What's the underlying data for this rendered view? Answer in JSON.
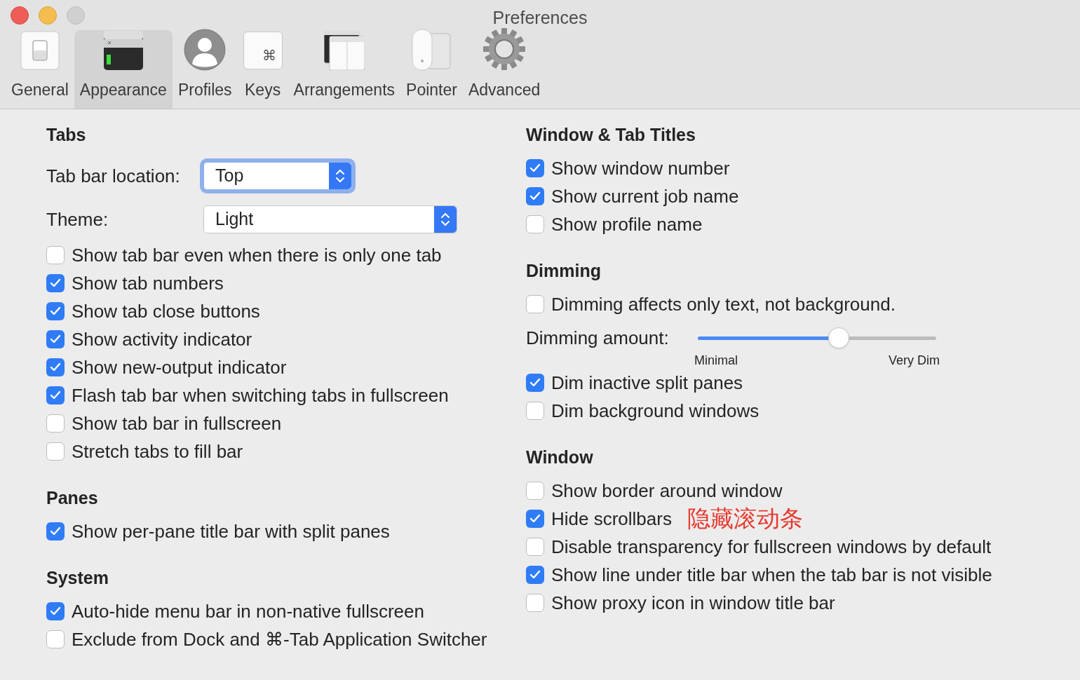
{
  "window": {
    "title": "Preferences"
  },
  "toolbar": [
    {
      "label": "General",
      "selected": false
    },
    {
      "label": "Appearance",
      "selected": true
    },
    {
      "label": "Profiles",
      "selected": false
    },
    {
      "label": "Keys",
      "glyph": "⌘",
      "selected": false
    },
    {
      "label": "Arrangements",
      "selected": false
    },
    {
      "label": "Pointer",
      "selected": false
    },
    {
      "label": "Advanced",
      "selected": false
    }
  ],
  "left_sections": [
    {
      "title": "Tabs",
      "items": [
        {
          "kind": "popup",
          "label": "Tab bar location:",
          "value": "Top",
          "focused": true
        },
        {
          "kind": "popup",
          "label": "Theme:",
          "value": "Light",
          "focused": false
        },
        {
          "kind": "checkbox",
          "label": "Show tab bar even when there is only one tab",
          "checked": false
        },
        {
          "kind": "checkbox",
          "label": "Show tab numbers",
          "checked": true
        },
        {
          "kind": "checkbox",
          "label": "Show tab close buttons",
          "checked": true
        },
        {
          "kind": "checkbox",
          "label": "Show activity indicator",
          "checked": true
        },
        {
          "kind": "checkbox",
          "label": "Show new-output indicator",
          "checked": true
        },
        {
          "kind": "checkbox",
          "label": "Flash tab bar when switching tabs in fullscreen",
          "checked": true
        },
        {
          "kind": "checkbox",
          "label": "Show tab bar in fullscreen",
          "checked": false
        },
        {
          "kind": "checkbox",
          "label": "Stretch tabs to fill bar",
          "checked": false
        }
      ]
    },
    {
      "title": "Panes",
      "items": [
        {
          "kind": "checkbox",
          "label": "Show per-pane title bar with split panes",
          "checked": true
        }
      ]
    },
    {
      "title": "System",
      "items": [
        {
          "kind": "checkbox",
          "label": "Auto-hide menu bar in non-native fullscreen",
          "checked": true
        },
        {
          "kind": "checkbox",
          "label": "Exclude from Dock and ⌘-Tab Application Switcher",
          "checked": false
        }
      ]
    }
  ],
  "right_sections": [
    {
      "title": "Window & Tab Titles",
      "items": [
        {
          "kind": "checkbox",
          "label": "Show window number",
          "checked": true
        },
        {
          "kind": "checkbox",
          "label": "Show current job name",
          "checked": true
        },
        {
          "kind": "checkbox",
          "label": "Show profile name",
          "checked": false
        }
      ]
    },
    {
      "title": "Dimming",
      "items": [
        {
          "kind": "checkbox",
          "label": "Dimming affects only text, not background.",
          "checked": false
        },
        {
          "kind": "slider",
          "label": "Dimming amount:",
          "level": 0.59,
          "min_label": "Minimal",
          "max_label": "Very Dim"
        },
        {
          "kind": "checkbox",
          "label": "Dim inactive split panes",
          "checked": true
        },
        {
          "kind": "checkbox",
          "label": "Dim background windows",
          "checked": false
        }
      ]
    },
    {
      "title": "Window",
      "items": [
        {
          "kind": "checkbox",
          "label": "Show border around window",
          "checked": false
        },
        {
          "kind": "checkbox",
          "label": "Hide scrollbars",
          "checked": true,
          "annotation": "隐藏滚动条"
        },
        {
          "kind": "checkbox",
          "label": "Disable transparency for fullscreen windows by default",
          "checked": false
        },
        {
          "kind": "checkbox",
          "label": "Show line under title bar when the tab bar is not visible",
          "checked": true
        },
        {
          "kind": "checkbox",
          "label": "Show proxy icon in window title bar",
          "checked": false
        }
      ]
    }
  ]
}
